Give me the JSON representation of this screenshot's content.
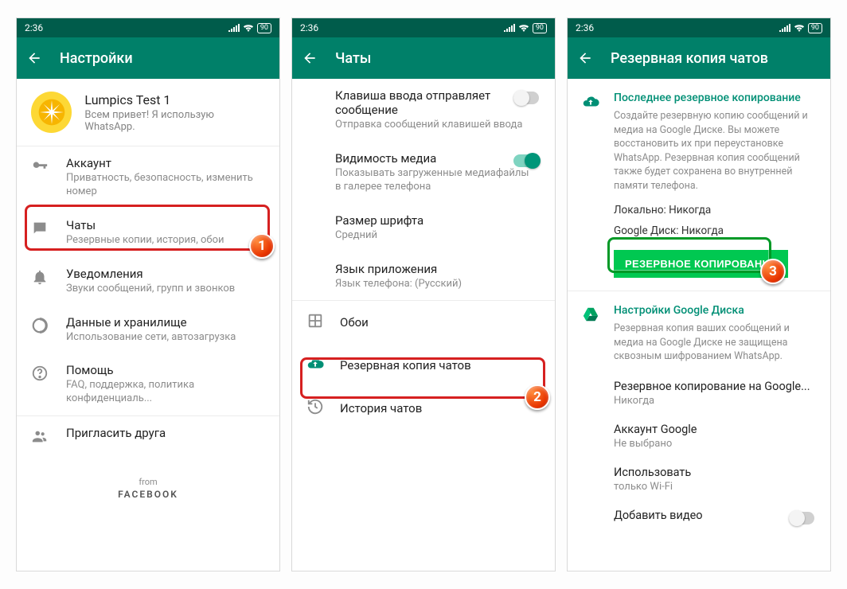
{
  "status": {
    "time": "2:36",
    "battery": "90"
  },
  "screen1": {
    "title": "Настройки",
    "profile": {
      "name": "Lumpics Test 1",
      "status": "Всем привет! Я использую WhatsApp."
    },
    "items": [
      {
        "label": "Аккаунт",
        "sub": "Приватность, безопасность, изменить номер"
      },
      {
        "label": "Чаты",
        "sub": "Резервные копии, история, обои"
      },
      {
        "label": "Уведомления",
        "sub": "Звуки сообщений, групп и звонков"
      },
      {
        "label": "Данные и хранилище",
        "sub": "Использование сети, автозагрузка"
      },
      {
        "label": "Помощь",
        "sub": "FAQ, поддержка, политика конфиденциаль..."
      },
      {
        "label": "Пригласить друга",
        "sub": ""
      }
    ],
    "from": "from",
    "facebook": "FACEBOOK"
  },
  "screen2": {
    "title": "Чаты",
    "items": [
      {
        "label": "Клавиша ввода отправляет сообщение",
        "sub": "Отправка сообщений клавишей ввода",
        "switch": "off"
      },
      {
        "label": "Видимость медиа",
        "sub": "Показывать загруженные медиафайлы в галерее телефона",
        "switch": "on"
      },
      {
        "label": "Размер шрифта",
        "sub": "Средний"
      },
      {
        "label": "Язык приложения",
        "sub": "Язык телефона: (Русский)"
      }
    ],
    "rows": [
      {
        "label": "Обои"
      },
      {
        "label": "Резервная копия чатов"
      },
      {
        "label": "История чатов"
      }
    ]
  },
  "screen3": {
    "title": "Резервная копия чатов",
    "section1": {
      "title": "Последнее резервное копирование",
      "body": "Создайте резервную копию сообщений и медиа на Google Диске. Вы можете восстановить их при переустановке WhatsApp. Резервная копия сообщений также будет сохранена во внутренней памяти телефона."
    },
    "local": "Локально: Никогда",
    "gdrive": "Google Диск: Никогда",
    "button": "РЕЗЕРВНОЕ КОПИРОВАНИЕ",
    "section2": {
      "title": "Настройки Google Диска",
      "body": "Резервная копия ваших сообщений и медиа на Google Диске не защищена сквозным шифрованием WhatsApp."
    },
    "opts": [
      {
        "label": "Резервное копирование на Google...",
        "sub": "Никогда"
      },
      {
        "label": "Аккаунт Google",
        "sub": "Не выбрано"
      },
      {
        "label": "Использовать",
        "sub": "только Wi-Fi"
      },
      {
        "label": "Добавить видео",
        "sub": "",
        "switch": "off"
      }
    ]
  },
  "badges": {
    "b1": "1",
    "b2": "2",
    "b3": "3"
  }
}
